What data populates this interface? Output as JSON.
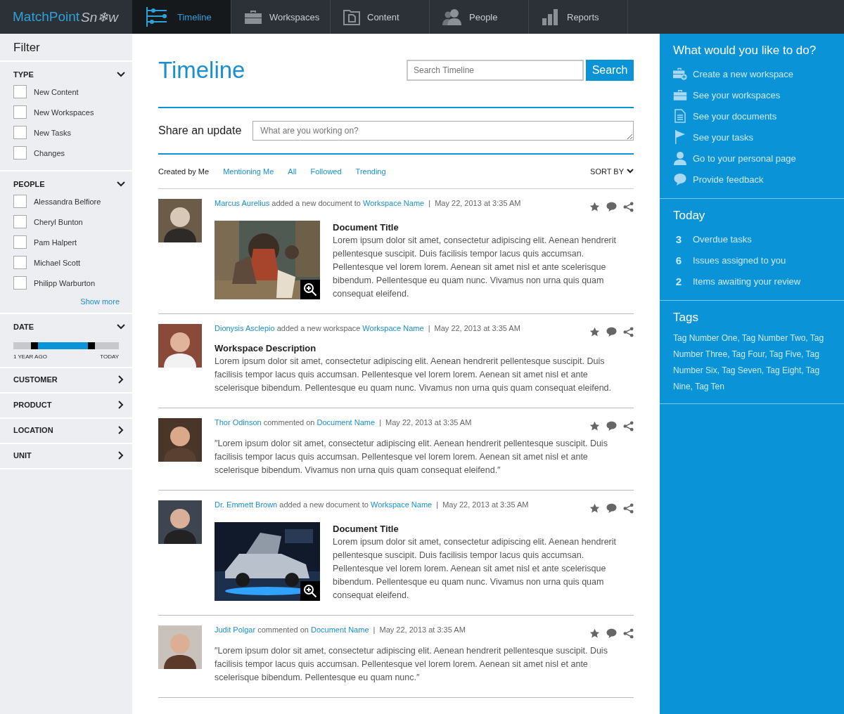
{
  "app": {
    "logo": "MatchPoint",
    "logo_suffix": "Sn❄w"
  },
  "nav": [
    {
      "label": "Timeline",
      "selected": true
    },
    {
      "label": "Workspaces",
      "selected": false
    },
    {
      "label": "Content",
      "selected": false
    },
    {
      "label": "People",
      "selected": false
    },
    {
      "label": "Reports",
      "selected": false
    }
  ],
  "filter": {
    "title": "Filter",
    "sections": [
      {
        "kind": "checklist",
        "label": "TYPE",
        "expanded": true,
        "items": [
          {
            "label": "New Content",
            "checked": false
          },
          {
            "label": "New Workspaces",
            "checked": false
          },
          {
            "label": "New Tasks",
            "checked": false
          },
          {
            "label": "Changes",
            "checked": false
          }
        ]
      },
      {
        "kind": "checklist",
        "label": "PEOPLE",
        "expanded": true,
        "items": [
          {
            "label": "Alessandra Belfiore",
            "checked": false
          },
          {
            "label": "Cheryl Bunton",
            "checked": false
          },
          {
            "label": "Pam Halpert",
            "checked": false
          },
          {
            "label": "Michael Scott",
            "checked": false
          },
          {
            "label": "Philipp Warburton",
            "checked": false
          }
        ],
        "more": "Show more"
      },
      {
        "kind": "range",
        "label": "DATE",
        "expanded": true,
        "handles": [
          {
            "level": 0.2
          },
          {
            "level": 0.74
          }
        ],
        "min_label": "1 YEAR AGO",
        "max_label": "TODAY"
      },
      {
        "kind": "group",
        "label": "CUSTOMER",
        "expanded": false
      },
      {
        "kind": "group",
        "label": "PRODUCT",
        "expanded": false
      },
      {
        "kind": "group",
        "label": "LOCATION",
        "expanded": false
      },
      {
        "kind": "group",
        "label": "UNIT",
        "expanded": false
      }
    ]
  },
  "main": {
    "title": "Timeline",
    "search": {
      "placeholder": "Search Timeline",
      "button": "Search"
    },
    "share": {
      "label": "Share an update",
      "placeholder": "What are you working on?"
    },
    "filters": [
      {
        "label": "Created by Me",
        "selected": true
      },
      {
        "label": "Mentioning Me",
        "selected": false
      },
      {
        "label": "All",
        "selected": false
      },
      {
        "label": "Followed",
        "selected": false
      },
      {
        "label": "Trending",
        "selected": false
      }
    ],
    "sort": "SORT BY",
    "posts": [
      {
        "kind": "document",
        "author": "Marcus Aurelius",
        "action": "added a new document to",
        "target": "Workspace Name",
        "separator": "|",
        "date": "May 22, 2013 at 3:35 AM",
        "title": "Document Title",
        "body": "Lorem ipsum dolor sit amet, consectetur adipiscing elit. Aenean hendrerit pellentesque suscipit. Duis facilisis tempor lacus quis accumsan. Pellentesque vel lorem lorem. Aenean sit amet nisl et ante scelerisque bibendum. Pellentesque eu quam nunc. Vivamus non urna quis quam consequat eleifend."
      },
      {
        "kind": "workspace",
        "author": "Dionysis Asclepio",
        "action": "added a new workspace",
        "target": "Workspace Name",
        "separator": "|",
        "date": "May 22, 2013 at 3:35 AM",
        "title": "Workspace Description",
        "body": "Lorem ipsum dolor sit amet, consectetur adipiscing elit. Aenean hendrerit pellentesque suscipit. Duis facilisis tempor lacus quis accumsan. Pellentesque vel lorem lorem. Aenean sit amet nisl et ante scelerisque bibendum. Pellentesque eu quam nunc. Vivamus non urna quis quam consequat eleifend."
      },
      {
        "kind": "comment",
        "author": "Thor Odinson",
        "action": "commented on",
        "target": "Document Name",
        "separator": "|",
        "date": "May 22, 2013 at 3:35 AM",
        "body": "″Lorem ipsum dolor sit amet, consectetur adipiscing elit. Aenean hendrerit pellentesque suscipit. Duis facilisis tempor lacus quis accumsan. Pellentesque vel lorem lorem. Aenean sit amet nisl et ante scelerisque bibendum. Vivamus non urna quis quam consequat eleifend.″"
      },
      {
        "kind": "document",
        "author": "Dr. Emmett Brown",
        "action": "added a new document to",
        "target": "Workspace Name",
        "separator": "|",
        "date": "May 22, 2013 at 3:35 AM",
        "title": "Document Title",
        "body": "Lorem ipsum dolor sit amet, consectetur adipiscing elit. Aenean hendrerit pellentesque suscipit. Duis facilisis tempor lacus quis accumsan. Pellentesque vel lorem lorem. Aenean sit amet nisl et ante scelerisque bibendum. Pellentesque eu quam nunc. Vivamus non urna quis quam consequat eleifend."
      },
      {
        "kind": "comment",
        "author": "Judit Polgar",
        "action": "commented on",
        "target": "Document Name",
        "separator": "|",
        "date": "May 22, 2013 at 3:35 AM",
        "body": "″Lorem ipsum dolor sit amet, consectetur adipiscing elit. Aenean hendrerit pellentesque suscipit. Duis facilisis tempor lacus quis accumsan. Pellentesque vel lorem lorem. Aenean sit amet nisl et ante scelerisque bibendum. Pellentesque eu quam nunc.″"
      }
    ]
  },
  "actions": {
    "title": "What would you like to do?",
    "items": [
      {
        "label": "Create a new workspace"
      },
      {
        "label": "See your workspaces"
      },
      {
        "label": "See your documents"
      },
      {
        "label": "See your tasks"
      },
      {
        "label": "Go to your personal page"
      },
      {
        "label": "Provide feedback"
      }
    ]
  },
  "today": {
    "title": "Today",
    "items": [
      {
        "count": "3",
        "label": "Overdue tasks"
      },
      {
        "count": "6",
        "label": "Issues assigned to you"
      },
      {
        "count": "2",
        "label": "Items awaiting your review"
      }
    ]
  },
  "tags": {
    "title": "Tags",
    "text": "Tag Number One, Tag Number Two, Tag Number Three, Tag Four, Tag Five, Tag Number Six, Tag Seven, Tag Eight, Tag Nine, Tag Ten"
  }
}
